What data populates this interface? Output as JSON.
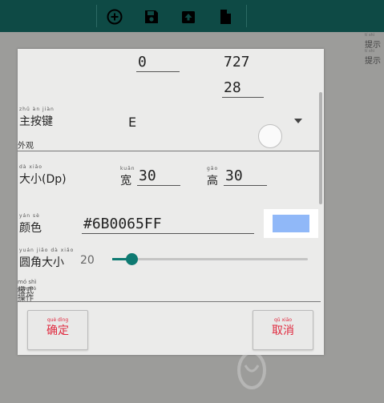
{
  "toolbar": {
    "icons": [
      "add-icon",
      "save-icon",
      "export-icon",
      "file-icon"
    ]
  },
  "side_hints": [
    {
      "pinyin": "tí shì",
      "text": "提示"
    },
    {
      "pinyin": "tí shì",
      "text": "提示"
    }
  ],
  "dialog": {
    "coords": {
      "x": "0",
      "y": "727",
      "z": "28"
    },
    "main_key": {
      "pinyin": "zhǔ àn jiàn",
      "label": "主按键",
      "value": "E"
    },
    "appearance": {
      "label": "外观"
    },
    "size": {
      "pinyin": "dà xiǎo",
      "label": "大小(Dp)",
      "width_pinyin": "kuān",
      "width_label": "宽",
      "width_value": "30",
      "height_pinyin": "gāo",
      "height_label": "高",
      "height_value": "30"
    },
    "color": {
      "pinyin": "yán sè",
      "label": "颜色",
      "value": "#6B0065FF",
      "swatch": "#90B8F8"
    },
    "corner": {
      "pinyin": "yuán jiǎo dà xiǎo",
      "label": "圆角大小",
      "value": "20",
      "slider_fraction": 0.1
    },
    "mode": {
      "pinyin": "mó shì",
      "label": "模式"
    },
    "action": {
      "pinyin": "cāo zuò",
      "label": "操作"
    },
    "ok_button": {
      "pinyin": "què dìng",
      "label": "确定"
    },
    "cancel_button": {
      "pinyin": "qǔ xiāo",
      "label": "取消"
    }
  },
  "colors": {
    "accent": "#0E7A72",
    "topbar": "#0E4A45",
    "button_text": "#E02A3F"
  }
}
